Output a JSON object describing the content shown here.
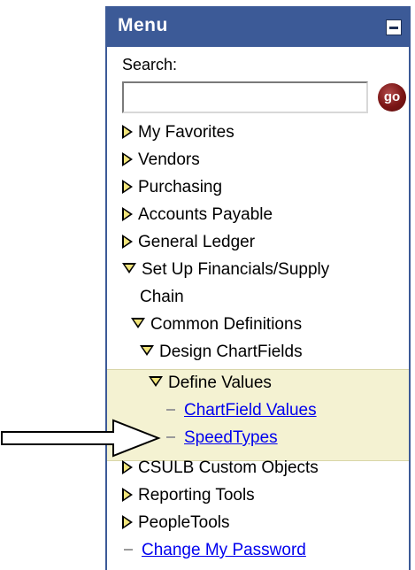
{
  "menu": {
    "title": "Menu",
    "search_label": "Search:",
    "search_value": "",
    "go_label": "go"
  },
  "items": {
    "my_favorites": "My Favorites",
    "vendors": "Vendors",
    "purchasing": "Purchasing",
    "accounts_payable": "Accounts Payable",
    "general_ledger": "General Ledger",
    "setup_line1": "Set Up Financials/Supply",
    "setup_line2": "Chain",
    "common_definitions": "Common Definitions",
    "design_chartfields": "Design ChartFields",
    "define_values": "Define Values",
    "chartfield_values": "ChartField Values",
    "speedtypes": "SpeedTypes",
    "csulb_custom_objects": "CSULB Custom Objects",
    "reporting_tools": "Reporting Tools",
    "peopletools": "PeopleTools",
    "change_password": "Change My Password"
  },
  "colors": {
    "header_bg": "#3c5a97",
    "highlight_bg": "#f4f2d2",
    "link": "#0000ee"
  },
  "icons": {
    "collapse": "minus-box-icon",
    "go": "go-button-icon",
    "expand": "triangle-right-icon",
    "expanded": "triangle-down-icon",
    "leaf": "dash-icon",
    "pointer": "outline-arrow-icon"
  }
}
